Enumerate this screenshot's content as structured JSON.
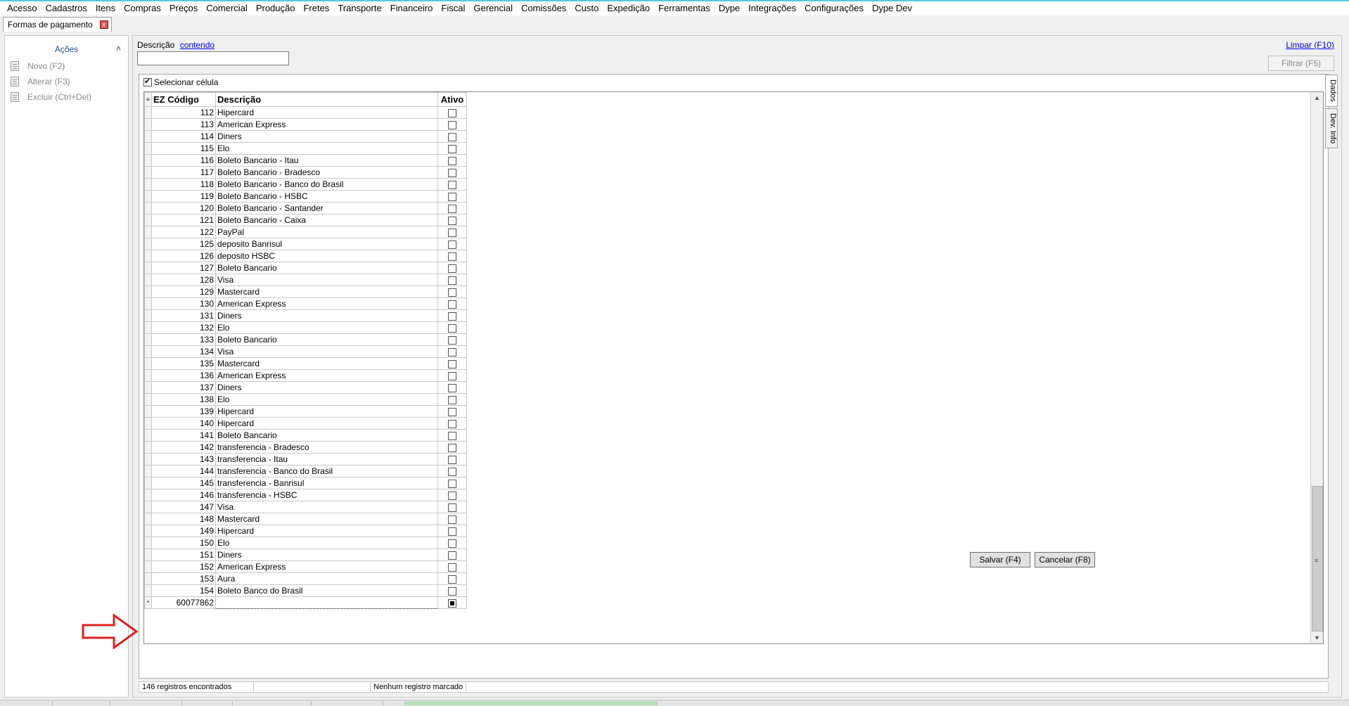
{
  "menu": [
    "Acesso",
    "Cadastros",
    "Itens",
    "Compras",
    "Preços",
    "Comercial",
    "Produção",
    "Fretes",
    "Transporte",
    "Financeiro",
    "Fiscal",
    "Gerencial",
    "Comissões",
    "Custo",
    "Expedição",
    "Ferramentas",
    "Dype",
    "Integrações",
    "Configurações",
    "Dype Dev"
  ],
  "tab": {
    "title": "Formas de pagamento",
    "close": "x"
  },
  "sidebar": {
    "header": "Ações",
    "actions": [
      {
        "label": "Novo (F2)",
        "icon": "document-icon"
      },
      {
        "label": "Alterar (F3)",
        "icon": "edit-document-icon"
      },
      {
        "label": "Excluir (Ctrl+Del)",
        "icon": "delete-document-icon"
      }
    ]
  },
  "filter": {
    "label": "Descrição",
    "mode": "contendo",
    "value": "",
    "clear": "Limpar (F10)",
    "apply": "Filtrar (F5)"
  },
  "grid": {
    "select_cell": "Selecionar célula",
    "select_cell_checked": true,
    "columns": {
      "code": "EZ Código",
      "desc": "Descrição",
      "active": "Ativo"
    },
    "rows": [
      {
        "code": "112",
        "desc": "Hipercard"
      },
      {
        "code": "113",
        "desc": "American Express"
      },
      {
        "code": "114",
        "desc": "Diners"
      },
      {
        "code": "115",
        "desc": "Elo"
      },
      {
        "code": "116",
        "desc": "Boleto Bancario - Itau"
      },
      {
        "code": "117",
        "desc": "Boleto Bancario - Bradesco"
      },
      {
        "code": "118",
        "desc": "Boleto Bancario - Banco do Brasil"
      },
      {
        "code": "119",
        "desc": "Boleto Bancario - HSBC"
      },
      {
        "code": "120",
        "desc": "Boleto Bancario - Santander"
      },
      {
        "code": "121",
        "desc": "Boleto Bancario - Caixa"
      },
      {
        "code": "122",
        "desc": "PayPal"
      },
      {
        "code": "125",
        "desc": "deposito Banrisul"
      },
      {
        "code": "126",
        "desc": "deposito HSBC"
      },
      {
        "code": "127",
        "desc": "Boleto Bancario"
      },
      {
        "code": "128",
        "desc": "Visa"
      },
      {
        "code": "129",
        "desc": "Mastercard"
      },
      {
        "code": "130",
        "desc": "American Express"
      },
      {
        "code": "131",
        "desc": "Diners"
      },
      {
        "code": "132",
        "desc": "Elo"
      },
      {
        "code": "133",
        "desc": "Boleto Bancario"
      },
      {
        "code": "134",
        "desc": "Visa"
      },
      {
        "code": "135",
        "desc": "Mastercard"
      },
      {
        "code": "136",
        "desc": "American Express"
      },
      {
        "code": "137",
        "desc": "Diners"
      },
      {
        "code": "138",
        "desc": "Elo"
      },
      {
        "code": "139",
        "desc": "Hipercard"
      },
      {
        "code": "140",
        "desc": "Hipercard"
      },
      {
        "code": "141",
        "desc": "Boleto Bancario"
      },
      {
        "code": "142",
        "desc": "transferencia - Bradesco"
      },
      {
        "code": "143",
        "desc": "transferencia - Itau"
      },
      {
        "code": "144",
        "desc": "transferencia - Banco do Brasil"
      },
      {
        "code": "145",
        "desc": "transferencia - Banrisul"
      },
      {
        "code": "146",
        "desc": "transferencia - HSBC"
      },
      {
        "code": "147",
        "desc": "Visa"
      },
      {
        "code": "148",
        "desc": "Mastercard"
      },
      {
        "code": "149",
        "desc": "Hipercard"
      },
      {
        "code": "150",
        "desc": "Elo"
      },
      {
        "code": "151",
        "desc": "Diners"
      },
      {
        "code": "152",
        "desc": "American Express"
      },
      {
        "code": "153",
        "desc": "Aura"
      },
      {
        "code": "154",
        "desc": "Boleto Banco do Brasil"
      }
    ],
    "new_row": {
      "indicator": "*",
      "code": "60077862",
      "desc": ""
    }
  },
  "status": {
    "count": "146 registros encontrados",
    "blank": "",
    "marked": "Nenhum registro marcado"
  },
  "side_tabs": [
    "Dados",
    "Dev. Info"
  ],
  "buttons": {
    "save": "Salvar (F4)",
    "cancel": "Cancelar (F8)"
  },
  "colors": {
    "accent_top": "#5ac8d8",
    "link": "#0000ee",
    "arrow": "#e02020"
  }
}
